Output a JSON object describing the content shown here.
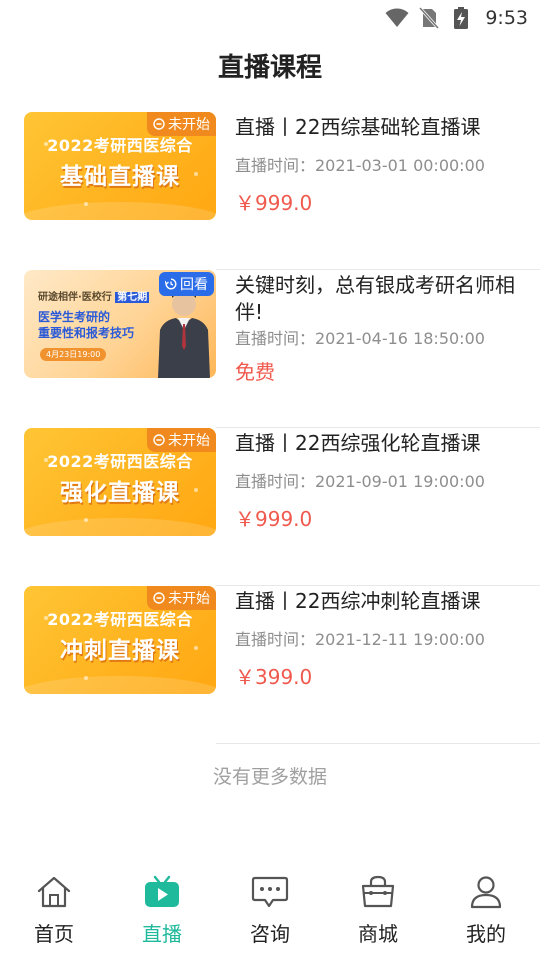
{
  "status_bar": {
    "time": "9:53",
    "icons": [
      "wifi-icon",
      "no-sim-icon",
      "battery-charging-icon"
    ]
  },
  "page": {
    "title": "直播课程"
  },
  "courses": [
    {
      "thumb_type": "orange",
      "thumb_line1": "2022考研西医综合",
      "thumb_line2": "基础直播课",
      "badge": "未开始",
      "badge_icon": "clock-icon",
      "title": "直播丨22西综基础轮直播课",
      "time": "直播时间：2021-03-01 00:00:00",
      "price": "￥999.0"
    },
    {
      "thumb_type": "promo",
      "thumb_topline": "研途相伴·医校行",
      "thumb_tag": "第七期",
      "thumb_line1": "医学生考研的",
      "thumb_line2": "重要性和报考技巧",
      "thumb_date": "4月23日19:00",
      "badge": "回看",
      "badge_icon": "replay-icon",
      "title": "关键时刻，总有银成考研名师相伴!",
      "time": "直播时间：2021-04-16 18:50:00",
      "price": "免费"
    },
    {
      "thumb_type": "orange",
      "thumb_line1": "2022考研西医综合",
      "thumb_line2": "强化直播课",
      "badge": "未开始",
      "badge_icon": "clock-icon",
      "title": "直播丨22西综强化轮直播课",
      "time": "直播时间：2021-09-01 19:00:00",
      "price": "￥999.0"
    },
    {
      "thumb_type": "orange",
      "thumb_line1": "2022考研西医综合",
      "thumb_line2": "冲刺直播课",
      "badge": "未开始",
      "badge_icon": "clock-icon",
      "title": "直播丨22西综冲刺轮直播课",
      "time": "直播时间：2021-12-11 19:00:00",
      "price": "￥399.0"
    }
  ],
  "no_more_text": "没有更多数据",
  "tabbar": {
    "items": [
      {
        "label": "首页",
        "icon": "home-icon",
        "active": false
      },
      {
        "label": "直播",
        "icon": "tv-icon",
        "active": true
      },
      {
        "label": "咨询",
        "icon": "chat-icon",
        "active": false
      },
      {
        "label": "商城",
        "icon": "shopping-bag-icon",
        "active": false
      },
      {
        "label": "我的",
        "icon": "user-icon",
        "active": false
      }
    ]
  },
  "colors": {
    "accent": "#1fb99c",
    "price": "#f05a4e",
    "badge_orange": "#f08a1e",
    "badge_blue": "#2b6de8"
  }
}
